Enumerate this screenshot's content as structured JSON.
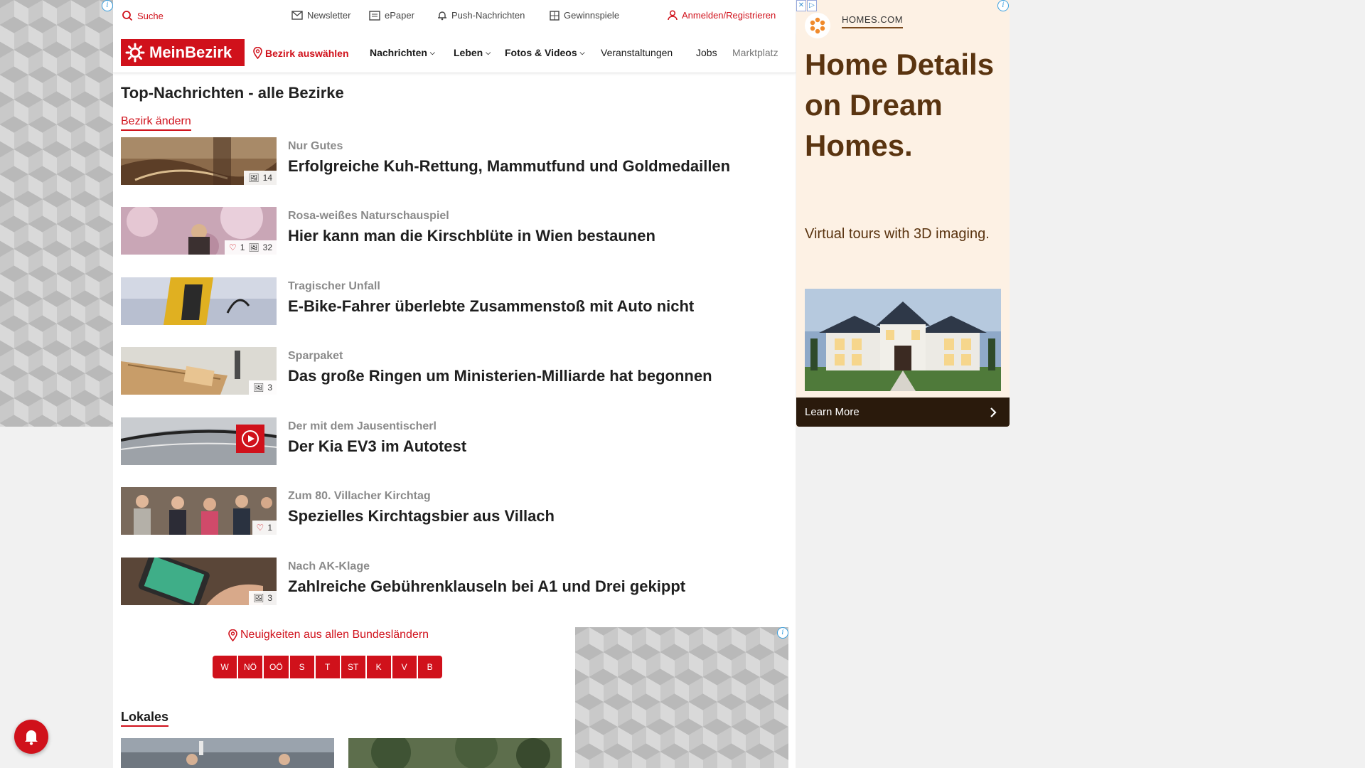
{
  "topbar": {
    "search": "Suche",
    "newsletter": "Newsletter",
    "epaper": "ePaper",
    "push": "Push-Nachrichten",
    "games": "Gewinnspiele",
    "login": "Anmelden/Registrieren"
  },
  "nav": {
    "logo_text": "MeinBezirk",
    "choose_district": "Bezirk auswählen",
    "items": [
      "Nachrichten",
      "Leben",
      "Fotos & Videos",
      "Veranstaltungen",
      "Jobs",
      "Marktplatz"
    ]
  },
  "section": {
    "title": "Top-Nachrichten - alle Bezirke",
    "change_link": "Bezirk ändern"
  },
  "articles": [
    {
      "kicker": "Nur Gutes",
      "headline": "Erfolgreiche Kuh-Rettung, Mammutfund und Goldmedaillen",
      "images": "14",
      "likes": ""
    },
    {
      "kicker": "Rosa-weißes Naturschauspiel",
      "headline": "Hier kann man die Kirschblüte in Wien bestaunen",
      "images": "32",
      "likes": "1"
    },
    {
      "kicker": "Tragischer Unfall",
      "headline": "E-Bike-Fahrer überlebte Zusammenstoß mit Auto nicht",
      "images": "",
      "likes": ""
    },
    {
      "kicker": "Sparpaket",
      "headline": "Das große Ringen um Ministerien-Milliarde hat begonnen",
      "images": "3",
      "likes": ""
    },
    {
      "kicker": "Der mit dem Jausentischerl",
      "headline": "Der Kia EV3 im Autotest",
      "images": "",
      "likes": ""
    },
    {
      "kicker": "Zum 80. Villacher Kirchtag",
      "headline": "Spezielles Kirchtagsbier aus Villach",
      "images": "",
      "likes": "1"
    },
    {
      "kicker": "Nach AK-Klage",
      "headline": "Zahlreiche Gebührenklauseln bei A1 und Drei gekippt",
      "images": "3",
      "likes": ""
    }
  ],
  "bundeslaender": {
    "label": "Neuigkeiten aus allen Bundesländern",
    "buttons": [
      "W",
      "NÖ",
      "OÖ",
      "S",
      "T",
      "ST",
      "K",
      "V",
      "B"
    ]
  },
  "lokales": {
    "title": "Lokales"
  },
  "ad": {
    "brand": "HOMES.COM",
    "headline": "Home Details on Dream Homes.",
    "sub": "Virtual tours with 3D imaging.",
    "cta": "Learn More"
  },
  "colors": {
    "accent": "#d0111b",
    "ad_background": "#fdf1e4",
    "ad_text": "#5a3410"
  }
}
